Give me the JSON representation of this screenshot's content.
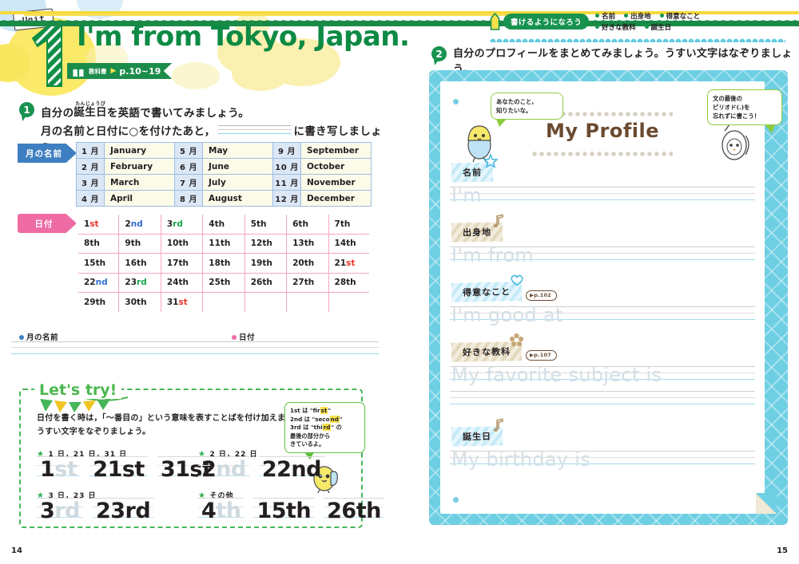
{
  "unit": {
    "tag_label": "Unit",
    "number": "1",
    "title": "I'm from Tokyo, Japan.",
    "textbook_ref_label": "教科書",
    "textbook_ref_arrow": "▶",
    "textbook_ref_pages": "p.10~19"
  },
  "task1": {
    "number": "1",
    "line1_pre": "自分の",
    "line1_ruby_base": "誕生日",
    "line1_ruby_text": "たんじょうび",
    "line1_post": "を英語で書いてみましょう。",
    "line2_pre": "月の名前と日付に○を付けたあと，",
    "line2_post": "に書き写しましょう。"
  },
  "month_table": {
    "tag_label": "月の名前",
    "rows": [
      [
        "1 月",
        "January",
        "5 月",
        "May",
        "9 月",
        "September"
      ],
      [
        "2 月",
        "February",
        "6 月",
        "June",
        "10 月",
        "October"
      ],
      [
        "3 月",
        "March",
        "7 月",
        "July",
        "11 月",
        "November"
      ],
      [
        "4 月",
        "April",
        "8 月",
        "August",
        "12 月",
        "December"
      ]
    ]
  },
  "date_table": {
    "tag_label": "日付",
    "rows": [
      [
        {
          "n": "1",
          "s": "st",
          "c": "st"
        },
        {
          "n": "2",
          "s": "nd",
          "c": "nd"
        },
        {
          "n": "3",
          "s": "rd",
          "c": "rd"
        },
        {
          "n": "4",
          "s": "th",
          "c": ""
        },
        {
          "n": "5",
          "s": "th",
          "c": ""
        },
        {
          "n": "6",
          "s": "th",
          "c": ""
        },
        {
          "n": "7",
          "s": "th",
          "c": ""
        }
      ],
      [
        {
          "n": "8",
          "s": "th",
          "c": ""
        },
        {
          "n": "9",
          "s": "th",
          "c": ""
        },
        {
          "n": "10",
          "s": "th",
          "c": ""
        },
        {
          "n": "11",
          "s": "th",
          "c": ""
        },
        {
          "n": "12",
          "s": "th",
          "c": ""
        },
        {
          "n": "13",
          "s": "th",
          "c": ""
        },
        {
          "n": "14",
          "s": "th",
          "c": ""
        }
      ],
      [
        {
          "n": "15",
          "s": "th",
          "c": ""
        },
        {
          "n": "16",
          "s": "th",
          "c": ""
        },
        {
          "n": "17",
          "s": "th",
          "c": ""
        },
        {
          "n": "18",
          "s": "th",
          "c": ""
        },
        {
          "n": "19",
          "s": "th",
          "c": ""
        },
        {
          "n": "20",
          "s": "th",
          "c": ""
        },
        {
          "n": "21",
          "s": "st",
          "c": "st"
        }
      ],
      [
        {
          "n": "22",
          "s": "nd",
          "c": "nd"
        },
        {
          "n": "23",
          "s": "rd",
          "c": "rd"
        },
        {
          "n": "24",
          "s": "th",
          "c": ""
        },
        {
          "n": "25",
          "s": "th",
          "c": ""
        },
        {
          "n": "26",
          "s": "th",
          "c": ""
        },
        {
          "n": "27",
          "s": "th",
          "c": ""
        },
        {
          "n": "28",
          "s": "th",
          "c": ""
        }
      ],
      [
        {
          "n": "29",
          "s": "th",
          "c": ""
        },
        {
          "n": "30",
          "s": "th",
          "c": ""
        },
        {
          "n": "31",
          "s": "st",
          "c": "st"
        },
        {
          "n": "",
          "s": "",
          "c": ""
        },
        {
          "n": "",
          "s": "",
          "c": ""
        },
        {
          "n": "",
          "s": "",
          "c": ""
        },
        {
          "n": "",
          "s": "",
          "c": ""
        }
      ]
    ],
    "suffix_colors": {
      "st": "#e8352a",
      "nd": "#2f6fd0",
      "rd": "#18a64e"
    }
  },
  "answer_area": {
    "label_month": "月の名前",
    "label_date": "日付"
  },
  "lets_try": {
    "title": "Let's try!",
    "desc_line1": "日付を書く時は，「～番目の」という意味を表すことばを付け加えます。",
    "desc_line2": "うすい文字をなぞりましょう。",
    "note": {
      "l1_a": "1st は ",
      "l1_b": "\"fir",
      "l1_hl": "st",
      "l1_c": "\"",
      "l2_a": "2nd は ",
      "l2_b": "\"seco",
      "l2_hl": "nd",
      "l2_c": "\"",
      "l3_a": "3rd は ",
      "l3_b": "\"thi",
      "l3_hl": "rd",
      "l3_c": "\" の",
      "l4": "最後の部分から",
      "l5": "きているよ。"
    },
    "groups": [
      {
        "heading": "1 日，21 日，31 日",
        "items": [
          {
            "ink": "1",
            "faint": "st"
          },
          {
            "ink": "21st",
            "faint": ""
          },
          {
            "ink": "31st",
            "faint": ""
          }
        ]
      },
      {
        "heading": "2 日，22 日",
        "items": [
          {
            "ink": "2",
            "faint": "nd"
          },
          {
            "ink": "22nd",
            "faint": ""
          }
        ]
      },
      {
        "heading": "3 日，23 日",
        "items": [
          {
            "ink": "3",
            "faint": "rd"
          },
          {
            "ink": "23rd",
            "faint": ""
          }
        ]
      },
      {
        "heading": "その他",
        "items": [
          {
            "ink": "4",
            "faint": "th"
          },
          {
            "ink": "15th",
            "faint": ""
          },
          {
            "ink": "26th",
            "faint": ""
          }
        ]
      }
    ]
  },
  "right_header": {
    "badge": "書けるようになろう",
    "tags_row1": [
      "名前",
      "出身地",
      "得意なこと"
    ],
    "tags_row2": [
      "好きな教科",
      "誕生日"
    ]
  },
  "task2": {
    "number": "2",
    "text": "自分のプロフィールをまとめてみましょう。うすい文字はなぞりましょう。"
  },
  "profile": {
    "title": "My Profile",
    "bubble_left_l1": "あなたのこと，",
    "bubble_left_l2": "知りたいな。",
    "bubble_right_l1": "文の最後の",
    "bubble_right_l2": "ピリオド(.)を",
    "bubble_right_l3": "忘れずに書こう！",
    "fields": [
      {
        "label": "名前",
        "icon": "star-icon",
        "tape": "blue",
        "ghost": "I'm",
        "page_ref": "",
        "extra_lines": 0
      },
      {
        "label": "出身地",
        "icon": "music-note-icon",
        "tape": "beige",
        "ghost": "I'm from",
        "page_ref": "",
        "extra_lines": 0
      },
      {
        "label": "得意なこと",
        "icon": "heart-icon",
        "tape": "blue",
        "ghost": "I'm good at",
        "page_ref": "▶p.102",
        "extra_lines": 0
      },
      {
        "label": "好きな教科",
        "icon": "flower-icon",
        "tape": "beige",
        "ghost": "My favorite subject is",
        "page_ref": "▶p.107",
        "extra_lines": 1
      },
      {
        "label": "誕生日",
        "icon": "music-note-icon",
        "tape": "blue",
        "ghost": "My birthday is",
        "page_ref": "",
        "extra_lines": 0
      }
    ]
  },
  "page_numbers": {
    "left": "14",
    "right": "15"
  },
  "colors": {
    "green": "#17934f",
    "title_green": "#0d8a44",
    "blue_tag": "#3e7fc1",
    "pink_tag": "#ee6ba3",
    "cyan_frame": "#6ecfe3",
    "brown": "#6b4a2f",
    "yellow": "#f5e14a"
  }
}
